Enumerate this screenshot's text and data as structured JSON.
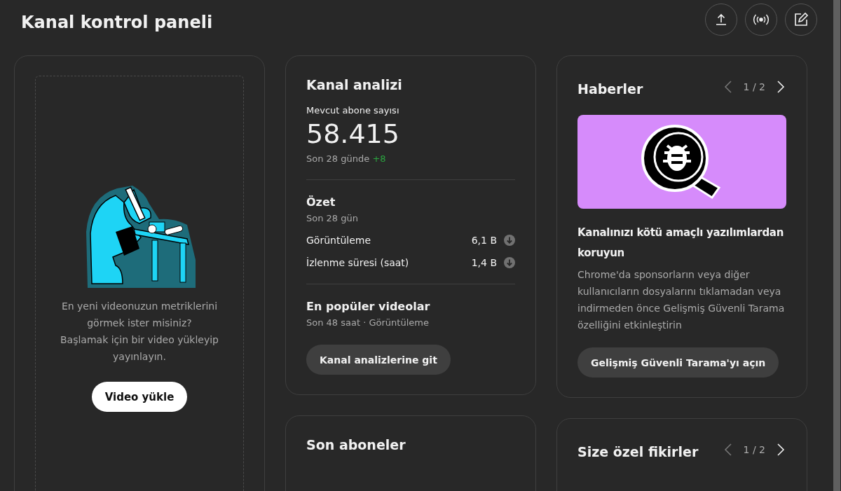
{
  "header": {
    "title": "Kanal kontrol paneli",
    "actions": [
      {
        "kind": "upload"
      },
      {
        "kind": "live"
      },
      {
        "kind": "edit"
      }
    ]
  },
  "upload_card": {
    "message_lines": [
      "En yeni videonuzun metriklerini görmek ister misiniz?",
      "Başlamak için bir video yükleyip yayınlayın."
    ],
    "button": "Video yükle"
  },
  "analytics_card": {
    "title": "Kanal analizi",
    "subscriber_label": "Mevcut abone sayısı",
    "subscriber_count": "58.415",
    "change_prefix": "Son 28 günde",
    "change": "+8",
    "summary_title": "Özet",
    "summary_period": "Son 28 gün",
    "metrics": [
      {
        "label": "Görüntüleme",
        "value": "6,1 B",
        "kind": "down"
      },
      {
        "label": "İzlenme süresi (saat)",
        "value": "1,4 B",
        "kind": "down"
      }
    ],
    "top_videos_title": "En popüler videolar",
    "top_videos_period": "Son 48 saat · Görüntüleme",
    "button": "Kanal analizlerine git"
  },
  "subscribers_card": {
    "title": "Son aboneler"
  },
  "news_card": {
    "title": "Haberler",
    "pager": "1 / 2",
    "prev_disabled": true,
    "next_disabled": false,
    "headline": "Kanalınızı kötü amaçlı yazılımlardan koruyun",
    "body": "Chrome'da sponsorların veya diğer kullanıcıların dosyalarını tıklamadan veya indirmeden önce Gelişmiş Güvenli Tarama özelliğini etkinleştirin",
    "button": "Gelişmiş Güvenli Tarama'yı açın"
  },
  "ideas_card": {
    "title": "Size özel fikirler",
    "pager": "1 / 2",
    "prev_disabled": true,
    "next_disabled": false
  }
}
